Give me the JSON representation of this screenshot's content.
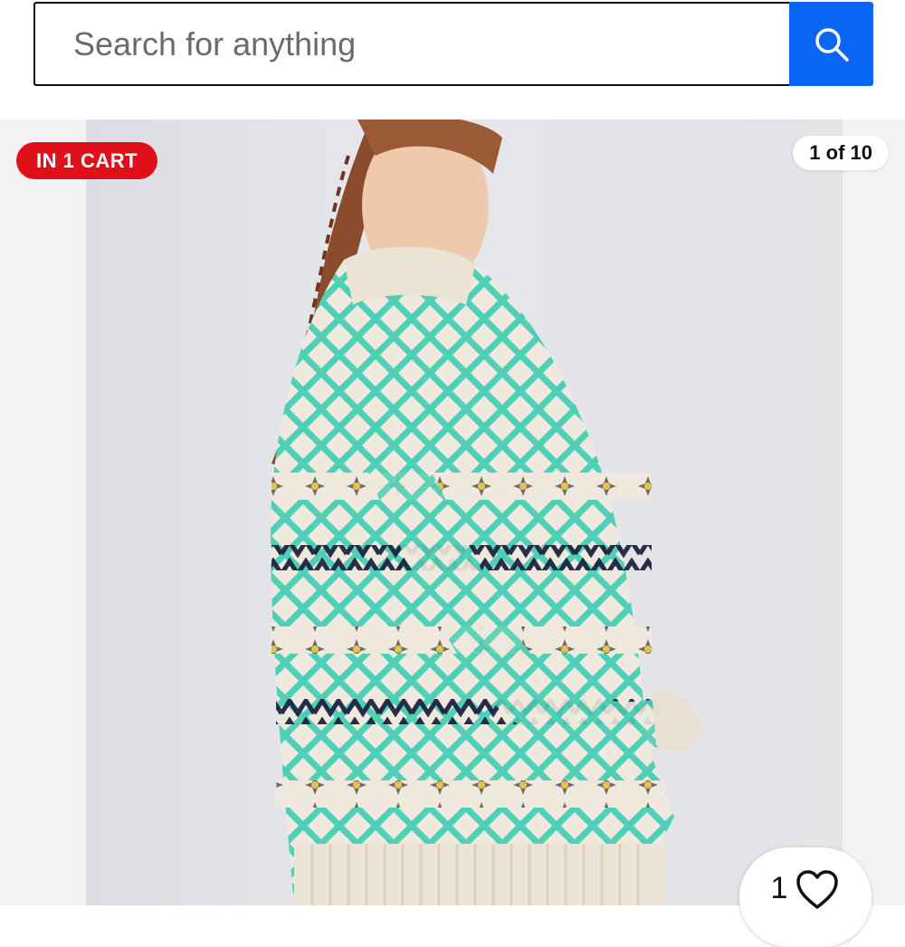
{
  "search": {
    "placeholder": "Search for anything",
    "value": "",
    "button_icon": "search-icon",
    "button_color": "#0a66f4"
  },
  "listing": {
    "cart_badge": "IN 1 CART",
    "cart_badge_color": "#e0101a",
    "image_counter": "1 of 10",
    "watchers": {
      "count": "1",
      "icon": "heart-outline-icon"
    }
  }
}
